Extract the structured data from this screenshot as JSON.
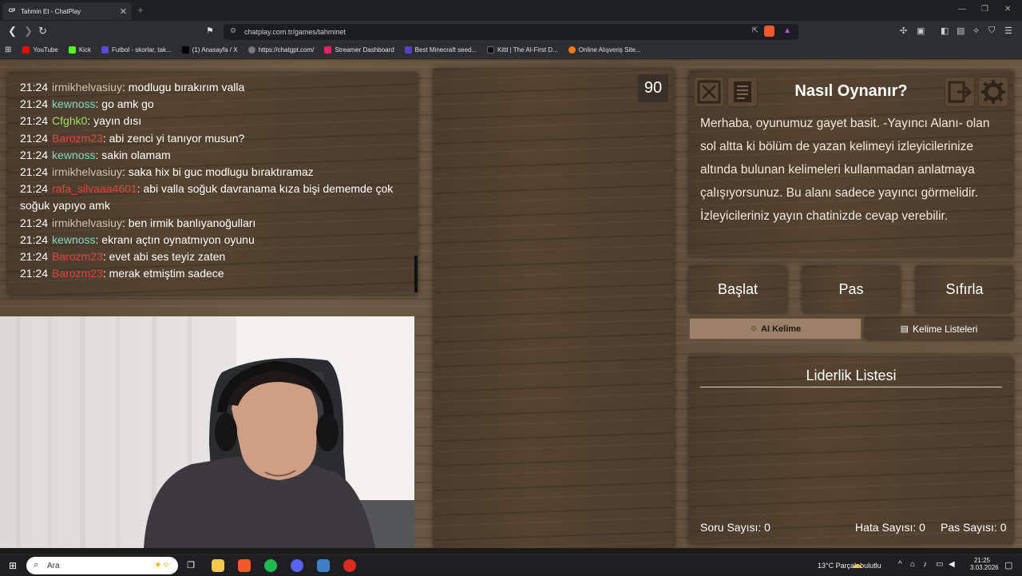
{
  "browser": {
    "tab_title": "Tahmin Et - ChatPlay",
    "tab_favicon": "CP",
    "url": "chatplay.com.tr/games/tahminet"
  },
  "bookmarks": [
    {
      "label": "YouTube",
      "icon": "youtube-icon",
      "color": "#ff0000"
    },
    {
      "label": "Kick",
      "icon": "kick-icon",
      "color": "#53fc18"
    },
    {
      "label": "Futbol - skorlar, tak...",
      "icon": "futbol-icon",
      "color": "#5b4ad8"
    },
    {
      "label": "(1) Anasayfa / X",
      "icon": "x-icon",
      "color": "#000000"
    },
    {
      "label": "https://chatgpt.com/",
      "icon": "chatgpt-icon",
      "color": "#777777"
    },
    {
      "label": "Streamer Dashboard",
      "icon": "streamer-icon",
      "color": "#e91e63"
    },
    {
      "label": "Best Minecraft seed...",
      "icon": "minecraft-icon",
      "color": "#5b3cc4"
    },
    {
      "label": "Kittl | The AI-First D...",
      "icon": "kittl-icon",
      "color": "#111111"
    },
    {
      "label": "Online Alışveriş Site...",
      "icon": "shop-icon",
      "color": "#f27a1a"
    }
  ],
  "chat": {
    "messages": [
      {
        "time": "21:24",
        "user": "irmikhelvasiuy",
        "text": ": modlugu bırakırım valla",
        "color": "u-grey"
      },
      {
        "time": "21:24",
        "user": "kewnoss",
        "text": ": go amk go",
        "color": "u-teal"
      },
      {
        "time": "21:24",
        "user": "Cfghk0",
        "text": ": yayın dısı",
        "color": "u-green"
      },
      {
        "time": "21:24",
        "user": "Barozm23",
        "text": ": abi zenci yi tanıyor musun?",
        "color": "u-red"
      },
      {
        "time": "21:24",
        "user": "kewnoss",
        "text": ": sakin olamam",
        "color": "u-teal"
      },
      {
        "time": "21:24",
        "user": "irmikhelvasiuy",
        "text": ": saka hix bi guc modlugu bıraktıramaz",
        "color": "u-grey"
      },
      {
        "time": "21:24",
        "user": "rafa_silvaaa4601",
        "text": ": abi valla soğuk davranama kıza bişi dememde çok soğuk yapıyo amk",
        "color": "u-red"
      },
      {
        "time": "21:24",
        "user": "irmikhelvasiuy",
        "text": ": ben irmik banlıyanoğulları",
        "color": "u-grey"
      },
      {
        "time": "21:24",
        "user": "kewnoss",
        "text": ": ekranı açtın oynatmıyon oyunu",
        "color": "u-teal"
      },
      {
        "time": "21:24",
        "user": "Barozm23",
        "text": ": evet abi ses teyiz zaten",
        "color": "u-red"
      },
      {
        "time": "21:24",
        "user": "Barozm23",
        "text": ": merak etmiştim sadece",
        "color": "u-red"
      }
    ]
  },
  "game": {
    "timer": "90",
    "howto": {
      "title": "Nasıl Oynanır?",
      "text": "Merhaba, oyunumuz gayet basit. -Yayıncı Alanı- olan sol altta ki bölüm de yazan kelimeyi izleyicilerinize altında bulunan kelimeleri kullanmadan anlatmaya çalışıyorsunuz. Bu alanı sadece yayıncı görmelidir. İzleyicileriniz yayın chatinizde cevap verebilir."
    },
    "buttons": {
      "start": "Başlat",
      "pass": "Pas",
      "reset": "Sıfırla",
      "ai_word": "AI Kelime",
      "word_lists": "Kelime Listeleri"
    },
    "leaderboard": {
      "title": "Liderlik Listesi"
    },
    "stats": {
      "questions_label": "Soru Sayısı:",
      "questions": "0",
      "errors_label": "Hata Sayısı:",
      "errors": "0",
      "passes_label": "Pas Sayısı:",
      "passes": "0"
    }
  },
  "taskbar": {
    "search_placeholder": "Ara",
    "weather": "13°C  Parçalı bulutlu",
    "time": "21:25",
    "date": "3.03.2026"
  }
}
